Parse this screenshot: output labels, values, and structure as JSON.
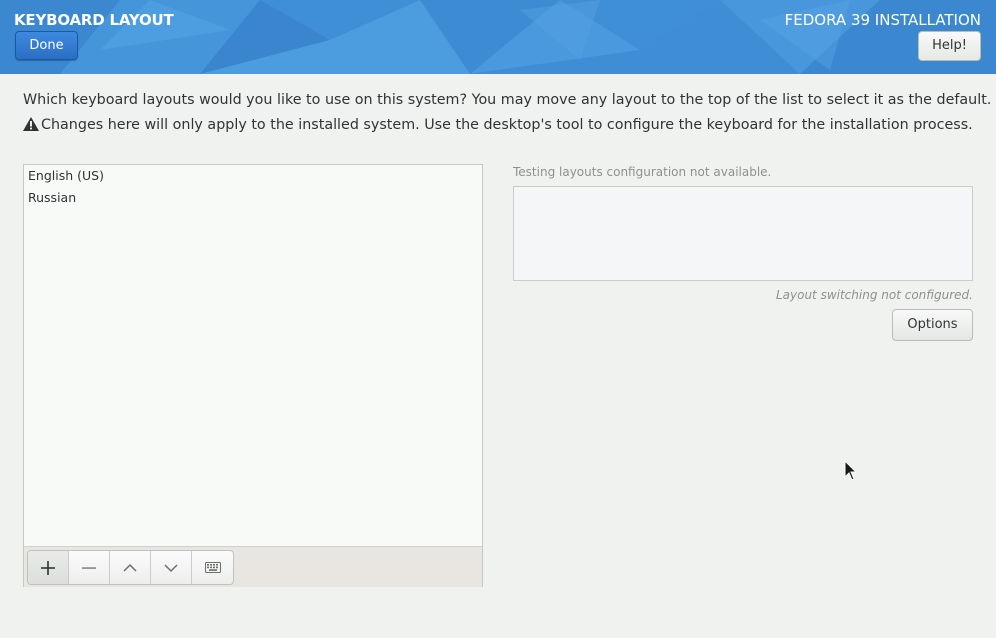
{
  "header": {
    "title": "KEYBOARD LAYOUT",
    "product": "FEDORA 39 INSTALLATION",
    "done_label": "Done",
    "help_label": "Help!"
  },
  "instructions": {
    "line1": "Which keyboard layouts would you like to use on this system?  You may move any layout to the top of the list to select it as the default.",
    "warning": "Changes here will only apply to the installed system. Use the desktop's tool to configure the keyboard for the installation process."
  },
  "layouts": {
    "items": [
      "English (US)",
      "Russian"
    ]
  },
  "toolbar": {
    "buttons": [
      "add-icon",
      "remove-icon",
      "move-up-icon",
      "move-down-icon",
      "keyboard-preview-icon"
    ]
  },
  "testing": {
    "label": "Testing layouts configuration not available.",
    "switching_label": "Layout switching not configured.",
    "options_label": "Options"
  },
  "colors": {
    "header_blue": "#3f8fd6",
    "done_blue": "#2b6fc4",
    "background": "#eff2ef"
  }
}
